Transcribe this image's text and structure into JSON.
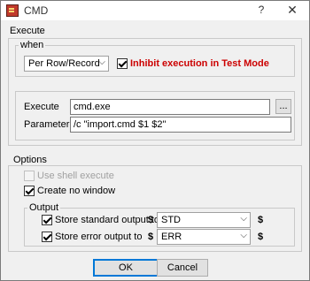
{
  "window": {
    "title": "CMD",
    "help_glyph": "?",
    "close_glyph": "✕"
  },
  "execute_group": {
    "label": "Execute",
    "when_group": {
      "label": "when",
      "mode_select": {
        "value": "Per Row/Record",
        "icon": "chevron-down-icon"
      },
      "inhibit_checkbox": {
        "label": "Inhibit execution in Test Mode",
        "checked": true,
        "color": "#cc0000"
      }
    },
    "command": {
      "execute_label": "Execute",
      "execute_value": "cmd.exe",
      "browse_label": "...",
      "parameter_label": "Parameter",
      "parameter_value": "/c \"import.cmd $1 $2\""
    }
  },
  "options_group": {
    "label": "Options",
    "use_shell_execute": {
      "label": "Use shell execute",
      "checked": false,
      "enabled": false
    },
    "create_no_window": {
      "label": "Create no window",
      "checked": true
    },
    "output_group": {
      "label": "Output",
      "rows": [
        {
          "label": "Store standard output to",
          "checked": true,
          "prefix": "$",
          "value": "STD",
          "suffix": "$"
        },
        {
          "label": "Store error output to",
          "checked": true,
          "prefix": "$",
          "value": "ERR",
          "suffix": "$"
        }
      ]
    }
  },
  "buttons": {
    "ok": "OK",
    "cancel": "Cancel"
  }
}
